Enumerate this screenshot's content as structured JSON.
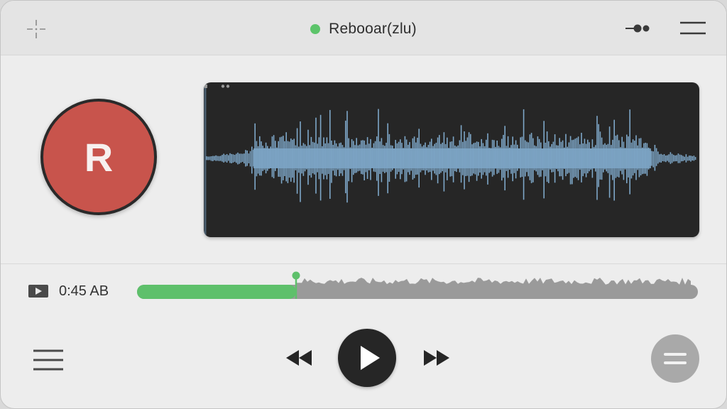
{
  "window": {
    "title": "Rebooar(zlu)",
    "status": "recording-active",
    "status_color": "#5cc46a"
  },
  "toolbar": {
    "left_icon": "crosshair-icon",
    "right_icons": [
      "more-dots-icon",
      "hamburger-menu-icon"
    ]
  },
  "recorder": {
    "record_button_label": "R",
    "record_color": "#c8544c"
  },
  "waveform": {
    "color": "#7ea7c8",
    "background": "#262626"
  },
  "playback": {
    "time_label": "0:45 AB",
    "progress": 0.285,
    "progress_color": "#5ec06b",
    "track_color": "#9a9a9a"
  },
  "controls": {
    "left_icon": "list-icon",
    "rewind_icon": "rewind-icon",
    "play_icon": "play-icon",
    "forward_icon": "fast-forward-icon",
    "right_icon": "options-icon"
  }
}
